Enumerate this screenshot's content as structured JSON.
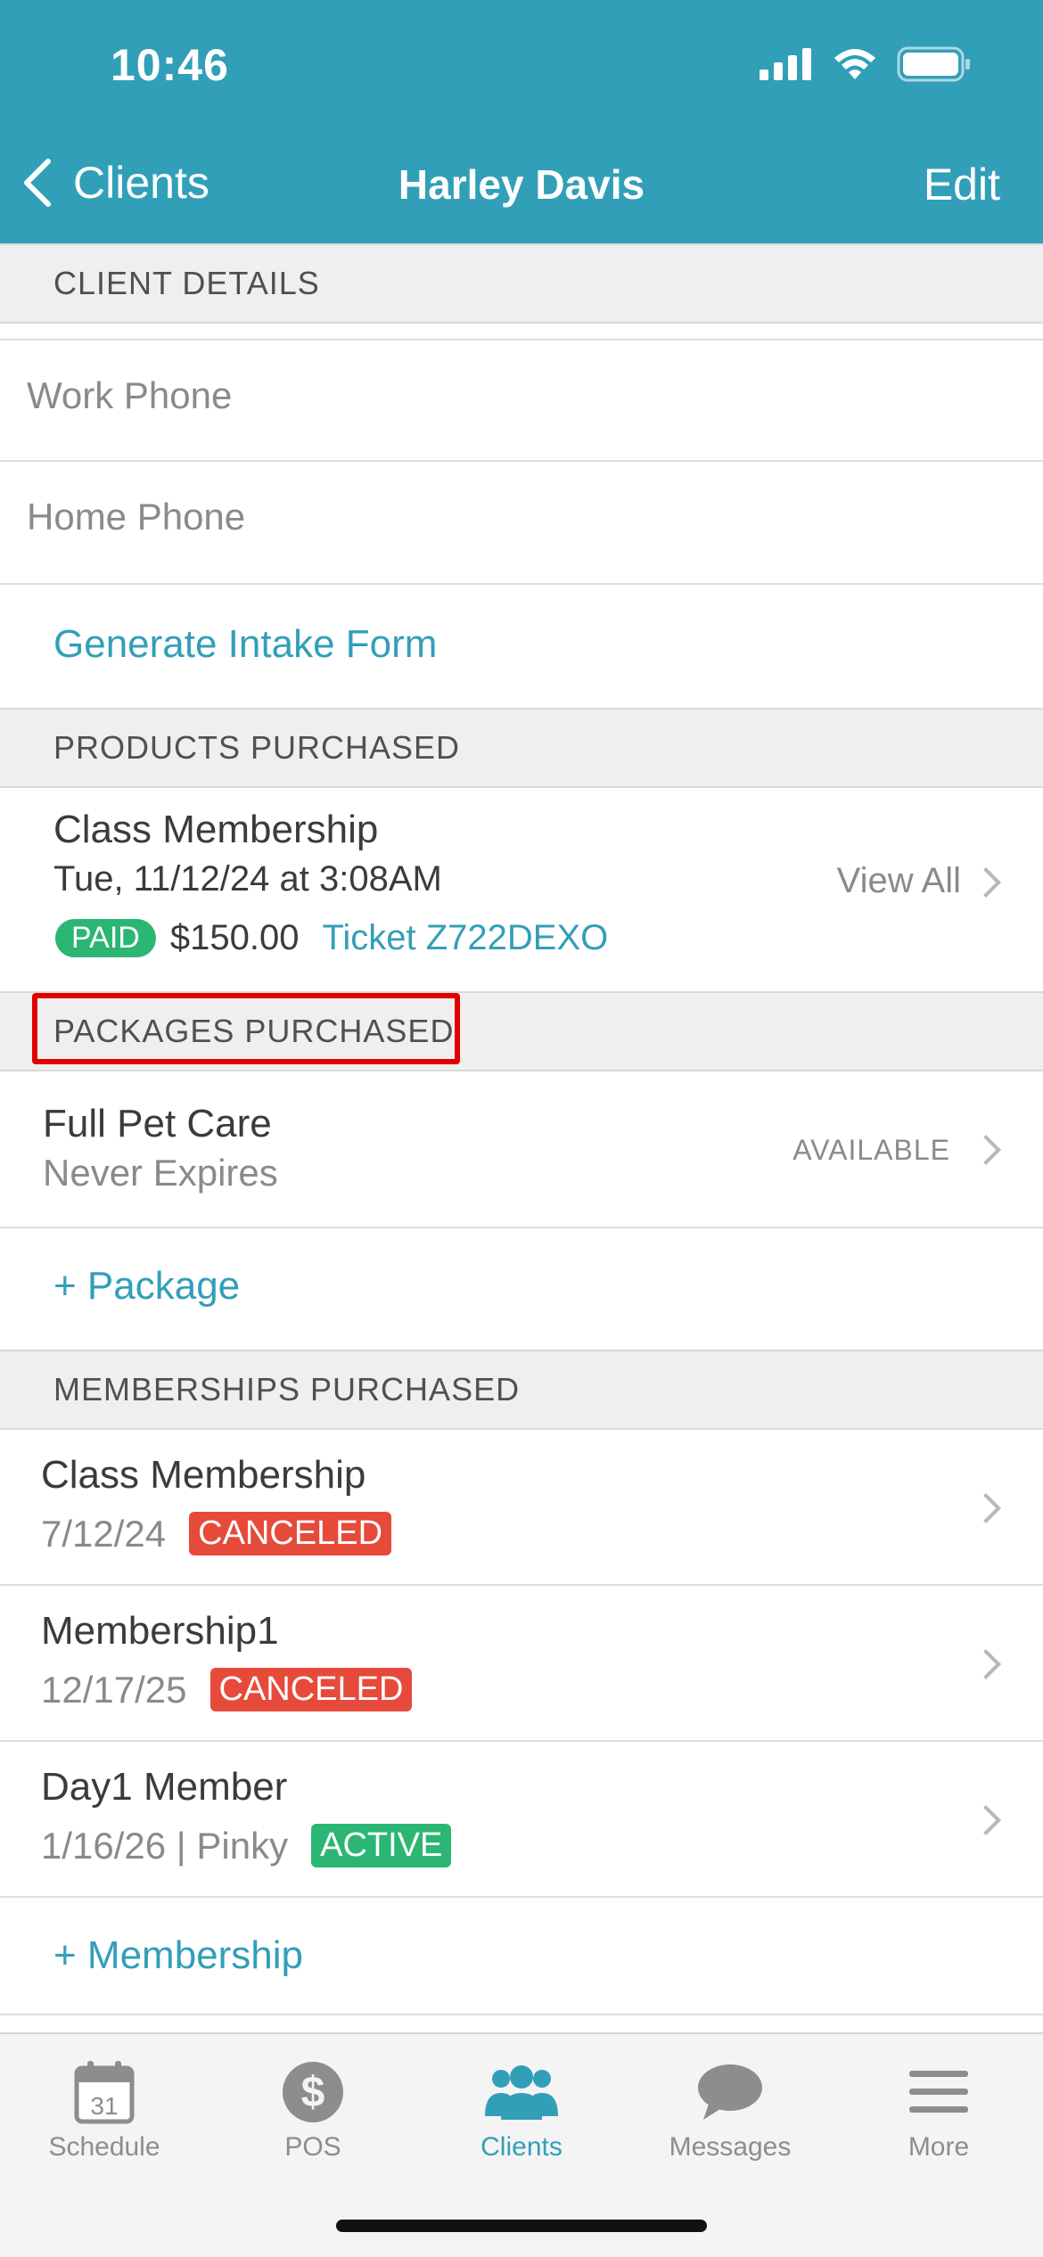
{
  "status_bar": {
    "time": "10:46"
  },
  "nav": {
    "back_label": "Clients",
    "title": "Harley Davis",
    "edit_label": "Edit"
  },
  "client_details": {
    "header": "CLIENT DETAILS",
    "work_phone_label": "Work Phone",
    "home_phone_label": "Home Phone",
    "generate_intake_label": "Generate Intake Form"
  },
  "products": {
    "header": "PRODUCTS PURCHASED",
    "item": {
      "name": "Class Membership",
      "date": "Tue, 11/12/24 at 3:08AM",
      "status": "PAID",
      "amount": "$150.00",
      "ticket": "Ticket Z722DEXO"
    },
    "view_all_label": "View All"
  },
  "packages": {
    "header": "PACKAGES PURCHASED",
    "item": {
      "name": "Full Pet Care",
      "expiry": "Never Expires",
      "status": "AVAILABLE"
    },
    "add_label": "+ Package"
  },
  "memberships": {
    "header": "MEMBERSHIPS PURCHASED",
    "items": [
      {
        "name": "Class Membership",
        "date": "7/12/24",
        "status": "CANCELED"
      },
      {
        "name": "Membership1",
        "date": "12/17/25",
        "status": "CANCELED"
      },
      {
        "name": "Day1 Member",
        "date": "1/16/26 | Pinky",
        "status": "ACTIVE"
      }
    ],
    "add_label": "+ Membership"
  },
  "tabbar": {
    "tabs": [
      {
        "label": "Schedule",
        "icon": "calendar-icon",
        "calendar_day": "31"
      },
      {
        "label": "POS",
        "icon": "dollar-icon"
      },
      {
        "label": "Clients",
        "icon": "clients-icon",
        "active": true
      },
      {
        "label": "Messages",
        "icon": "chat-icon"
      },
      {
        "label": "More",
        "icon": "menu-icon"
      }
    ]
  },
  "colors": {
    "brand": "#329fb8",
    "canceled": "#e64a3b",
    "active": "#2bb673",
    "highlight": "#e00000"
  }
}
